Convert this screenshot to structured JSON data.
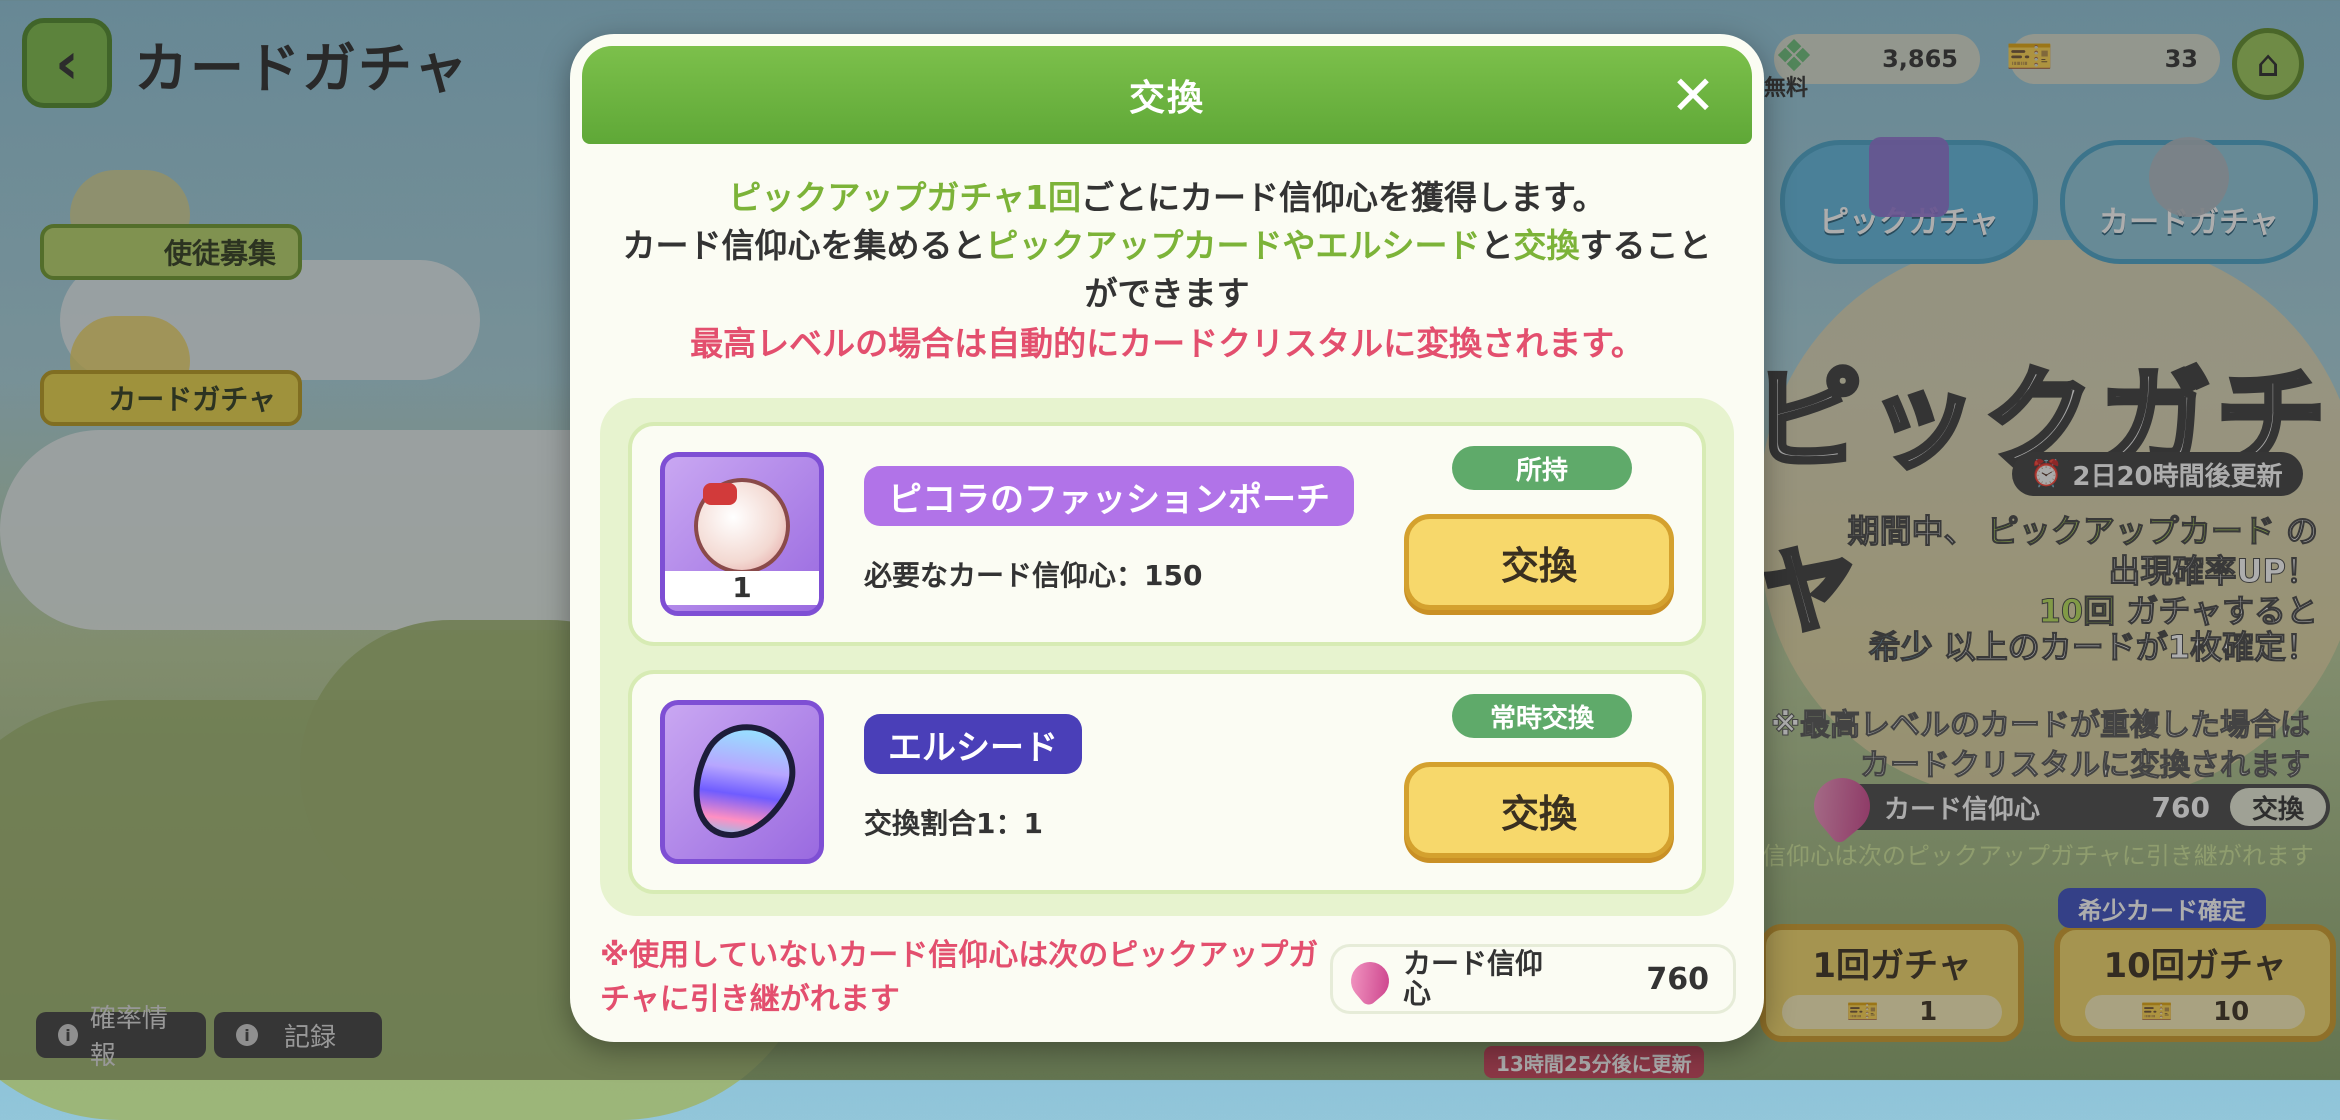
{
  "screen": {
    "title": "カードガチャ",
    "sidebar": [
      {
        "label": "使徒募集"
      },
      {
        "label": "カードガチャ"
      }
    ],
    "bottom_buttons": [
      {
        "label": "確率情報"
      },
      {
        "label": "記録"
      }
    ]
  },
  "currencies": {
    "free_label": "無料",
    "crystal_amount": "3,865",
    "ticket_amount": "33"
  },
  "tabs": [
    {
      "label": "ピックガチャ"
    },
    {
      "label": "カードガチャ"
    }
  ],
  "banner": {
    "title": "ピックガチャ",
    "timer": "2日20時間後更新",
    "desc": {
      "l1a": "期間中、",
      "l1b": "ピックアップカード",
      "l1c": "の",
      "l2": "出現確率UP！",
      "l3a": "10回",
      "l3b": "ガチャすると",
      "l4a": "希少",
      "l4b": "以上のカードが1枚確定！"
    },
    "note1": "※最高レベルのカードが重複した場合は",
    "note2": "カードクリスタルに変換されます",
    "faith_label": "カード信仰心",
    "faith_value": "760",
    "faith_exchange": "交換",
    "carry_note": "信仰心は次のピックアップガチャに引き継がれます",
    "rare_tag": "希少カード確定",
    "gacha1_label": "1回ガチャ",
    "gacha1_cost": "1",
    "gacha10_label": "10回ガチャ",
    "gacha10_cost": "10",
    "update_tag": "13時間25分後に更新"
  },
  "modal": {
    "title": "交換",
    "close": "✕",
    "intro": {
      "a": "ピックアップガチャ1回",
      "b": "ごとにカード信仰心を獲得します。",
      "c": "カード信仰心を集めると",
      "d": "ピックアップカードやエルシード",
      "e": "と",
      "f": "交換",
      "g": "することができます",
      "warn": "最高レベルの場合は自動的にカードクリスタルに変換されます。"
    },
    "items": [
      {
        "name": "ピコラのファッションポーチ",
        "requirement": "必要なカード信仰心：150",
        "status": "所持",
        "quantity": "1",
        "button": "交換"
      },
      {
        "name": "エルシード",
        "requirement": "交換割合1：1",
        "status": "常時交換",
        "button": "交換"
      }
    ],
    "footer_note": "※使用していないカード信仰心は次のピックアップガチャに引き継がれます",
    "balance_label": "カード信仰心",
    "balance_value": "760"
  }
}
